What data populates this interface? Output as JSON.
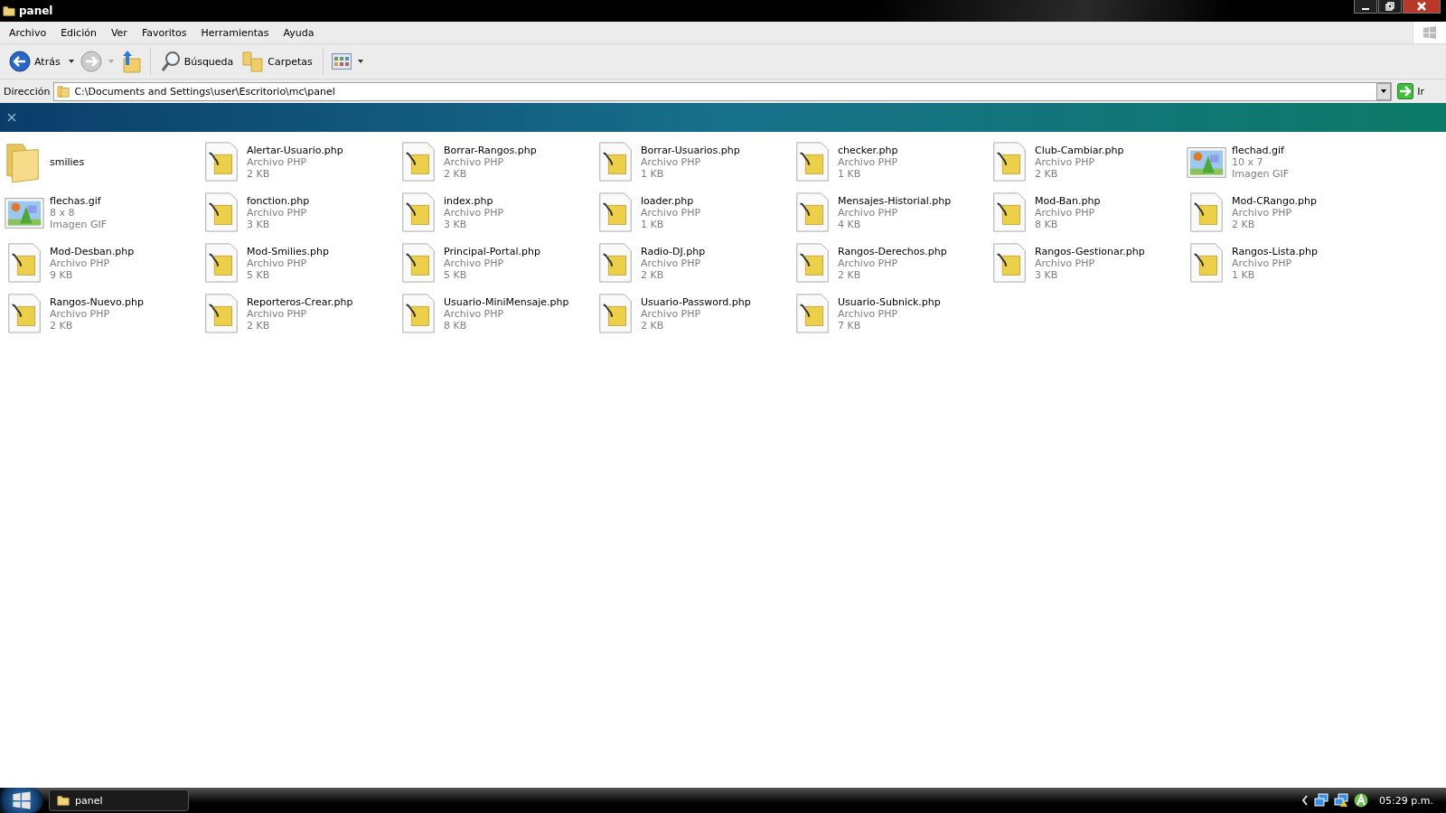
{
  "window": {
    "title": "panel"
  },
  "menu": [
    "Archivo",
    "Edición",
    "Ver",
    "Favoritos",
    "Herramientas",
    "Ayuda"
  ],
  "toolbar": {
    "back": "Atrás",
    "search": "Búsqueda",
    "folders": "Carpetas"
  },
  "address": {
    "label": "Dirección",
    "value": "C:\\Documents and Settings\\user\\Escritorio\\mc\\panel",
    "go": "Ir"
  },
  "items": [
    {
      "kind": "folder",
      "name": "smilies"
    },
    {
      "kind": "php",
      "name": "Alertar-Usuario.php",
      "details": [
        "Archivo PHP",
        "2 KB"
      ]
    },
    {
      "kind": "php",
      "name": "Borrar-Rangos.php",
      "details": [
        "Archivo PHP",
        "2 KB"
      ]
    },
    {
      "kind": "php",
      "name": "Borrar-Usuarios.php",
      "details": [
        "Archivo PHP",
        "1 KB"
      ]
    },
    {
      "kind": "php",
      "name": "checker.php",
      "details": [
        "Archivo PHP",
        "1 KB"
      ]
    },
    {
      "kind": "php",
      "name": "Club-Cambiar.php",
      "details": [
        "Archivo PHP",
        "2 KB"
      ]
    },
    {
      "kind": "gif",
      "name": "flechad.gif",
      "details": [
        "10 x 7",
        "Imagen GIF"
      ]
    },
    {
      "kind": "gif",
      "name": "flechas.gif",
      "details": [
        "8 x 8",
        "Imagen GIF"
      ]
    },
    {
      "kind": "php",
      "name": "fonction.php",
      "details": [
        "Archivo PHP",
        "3 KB"
      ]
    },
    {
      "kind": "php",
      "name": "index.php",
      "details": [
        "Archivo PHP",
        "3 KB"
      ]
    },
    {
      "kind": "php",
      "name": "loader.php",
      "details": [
        "Archivo PHP",
        "1 KB"
      ]
    },
    {
      "kind": "php",
      "name": "Mensajes-Historial.php",
      "details": [
        "Archivo PHP",
        "4 KB"
      ]
    },
    {
      "kind": "php",
      "name": "Mod-Ban.php",
      "details": [
        "Archivo PHP",
        "8 KB"
      ]
    },
    {
      "kind": "php",
      "name": "Mod-CRango.php",
      "details": [
        "Archivo PHP",
        "2 KB"
      ]
    },
    {
      "kind": "php",
      "name": "Mod-Desban.php",
      "details": [
        "Archivo PHP",
        "9 KB"
      ]
    },
    {
      "kind": "php",
      "name": "Mod-Smilies.php",
      "details": [
        "Archivo PHP",
        "5 KB"
      ]
    },
    {
      "kind": "php",
      "name": "Principal-Portal.php",
      "details": [
        "Archivo PHP",
        "5 KB"
      ]
    },
    {
      "kind": "php",
      "name": "Radio-DJ.php",
      "details": [
        "Archivo PHP",
        "2 KB"
      ]
    },
    {
      "kind": "php",
      "name": "Rangos-Derechos.php",
      "details": [
        "Archivo PHP",
        "2 KB"
      ]
    },
    {
      "kind": "php",
      "name": "Rangos-Gestionar.php",
      "details": [
        "Archivo PHP",
        "3 KB"
      ]
    },
    {
      "kind": "php",
      "name": "Rangos-Lista.php",
      "details": [
        "Archivo PHP",
        "1 KB"
      ]
    },
    {
      "kind": "php",
      "name": "Rangos-Nuevo.php",
      "details": [
        "Archivo PHP",
        "2 KB"
      ]
    },
    {
      "kind": "php",
      "name": "Reporteros-Crear.php",
      "details": [
        "Archivo PHP",
        "2 KB"
      ]
    },
    {
      "kind": "php",
      "name": "Usuario-MiniMensaje.php",
      "details": [
        "Archivo PHP",
        "8 KB"
      ]
    },
    {
      "kind": "php",
      "name": "Usuario-Password.php",
      "details": [
        "Archivo PHP",
        "2 KB"
      ]
    },
    {
      "kind": "php",
      "name": "Usuario-Subnick.php",
      "details": [
        "Archivo PHP",
        "7 KB"
      ]
    }
  ],
  "taskbar": {
    "button": "panel",
    "clock": "05:29 p.m."
  }
}
